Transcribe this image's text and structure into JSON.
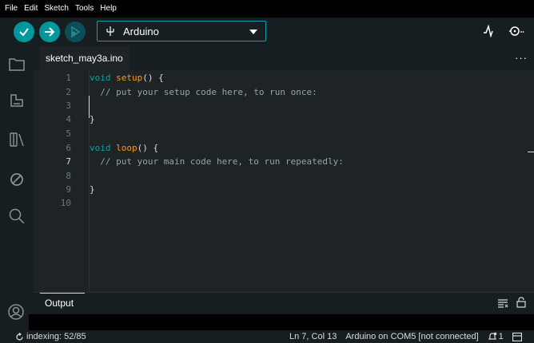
{
  "menubar": {
    "items": [
      "File",
      "Edit",
      "Sketch",
      "Tools",
      "Help"
    ]
  },
  "toolbar": {
    "verify_icon": "check-icon",
    "upload_icon": "arrow-right-icon",
    "debug_icon": "debug-icon",
    "board_icon": "usb-icon",
    "board_name": "Arduino",
    "plotter_icon": "serial-plotter-icon",
    "monitor_icon": "serial-monitor-icon"
  },
  "sidebar": {
    "items": [
      "folder-icon",
      "boards-manager-icon",
      "library-manager-icon",
      "debug-off-icon",
      "search-icon"
    ],
    "account_icon": "account-icon"
  },
  "tab": {
    "filename": "sketch_may3a.ino",
    "more": "···"
  },
  "editor": {
    "line_numbers": [
      "1",
      "2",
      "3",
      "4",
      "5",
      "6",
      "7",
      "8",
      "9",
      "10"
    ],
    "active_line": 7
  },
  "output": {
    "title": "Output",
    "clear_icon": "clear-output-icon",
    "lock_icon": "lock-icon"
  },
  "status": {
    "indexing": "indexing: 52/85",
    "position": "Ln 7, Col 13",
    "board": "Arduino on COM5 [not connected]",
    "notifications": "1"
  },
  "colors": {
    "accent": "#00979d",
    "keyword": "#0ca1a6",
    "function": "#f39c12",
    "comment": "#95a5a6"
  }
}
